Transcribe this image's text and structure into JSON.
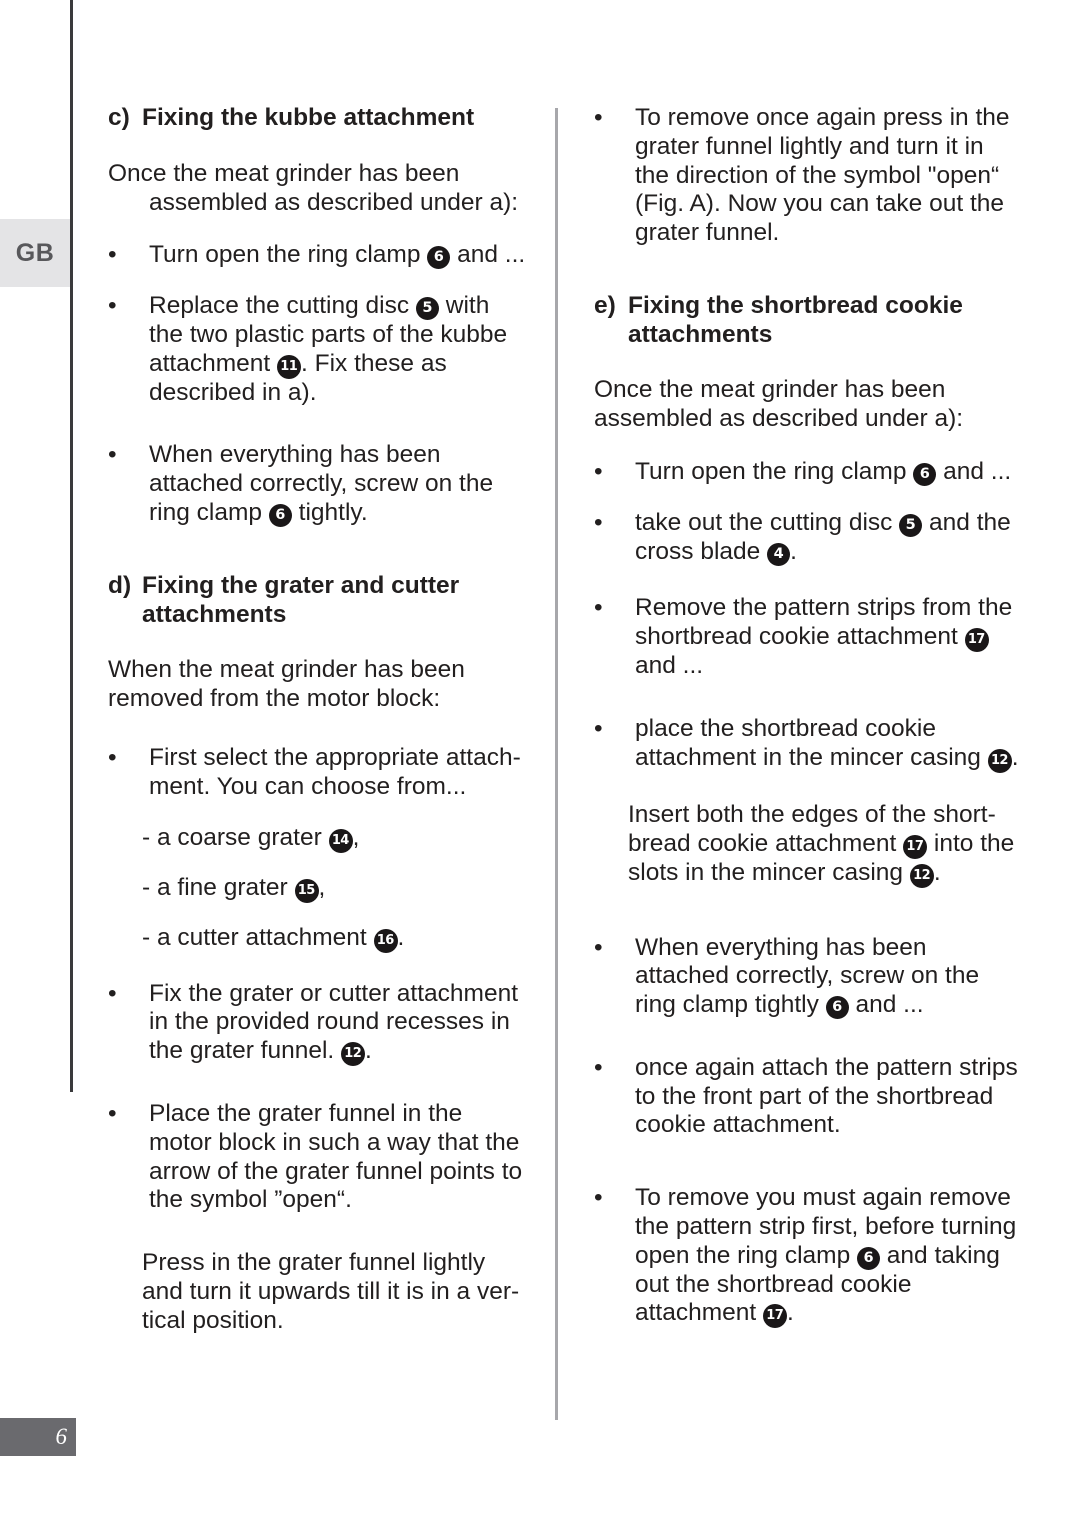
{
  "page": {
    "language_tab": "GB",
    "page_number": "6"
  },
  "left_column": {
    "section_c": {
      "marker": "c)",
      "title": "Fixing the kubbe attachment",
      "intro": "Once the meat grinder has been assembled as described under a):",
      "bullets": [
        {
          "parts": [
            {
              "type": "text",
              "value": "Turn open the ring clamp "
            },
            {
              "type": "badge",
              "value": "6"
            },
            {
              "type": "text",
              "value": " and ..."
            }
          ]
        },
        {
          "parts": [
            {
              "type": "text",
              "value": "Replace the cutting disc "
            },
            {
              "type": "badge",
              "value": "5"
            },
            {
              "type": "text",
              "value": " with the two plastic parts of the kubbe attachment "
            },
            {
              "type": "badge",
              "value": "11"
            },
            {
              "type": "text",
              "value": ". Fix these as described in a)."
            }
          ]
        },
        {
          "parts": [
            {
              "type": "text",
              "value": "When everything has been attached correctly, screw on the ring clamp "
            },
            {
              "type": "badge",
              "value": "6"
            },
            {
              "type": "text",
              "value": " tightly."
            }
          ]
        }
      ]
    },
    "section_d": {
      "marker": "d)",
      "title": "Fixing the grater and cutter attachments",
      "intro": "When the meat grinder has been removed from the motor block:",
      "bullet_first": {
        "parts": [
          {
            "type": "text",
            "value": "First select the appropriate attach-ment. You can choose from..."
          }
        ]
      },
      "bullet_first_text": "First select the appropriate attach­ment. You can choose from...",
      "dash_items": [
        {
          "parts": [
            {
              "type": "text",
              "value": "- a coarse grater "
            },
            {
              "type": "badge",
              "value": "14"
            },
            {
              "type": "text",
              "value": ","
            }
          ]
        },
        {
          "parts": [
            {
              "type": "text",
              "value": "- a fine grater "
            },
            {
              "type": "badge",
              "value": "15"
            },
            {
              "type": "text",
              "value": ","
            }
          ]
        },
        {
          "parts": [
            {
              "type": "text",
              "value": "- a cutter attachment "
            },
            {
              "type": "badge",
              "value": "16"
            },
            {
              "type": "text",
              "value": "."
            }
          ]
        }
      ],
      "bullets": [
        {
          "parts": [
            {
              "type": "text",
              "value": "Fix the grater or cutter attachment in the provided round recesses in the grater funnel. "
            },
            {
              "type": "badge",
              "value": "12"
            },
            {
              "type": "text",
              "value": "."
            }
          ]
        },
        {
          "parts": [
            {
              "type": "text",
              "value": "Place the grater funnel in the motor block in such a way that the arrow of the grater funnel points to the symbol ”open“."
            }
          ]
        }
      ],
      "closing_para": "Press in the grater funnel lightly and turn it upwards till it is in a ver­tical position."
    }
  },
  "right_column": {
    "top_bullet": {
      "parts": [
        {
          "type": "text",
          "value": "To remove once again press in the grater funnel lightly and turn it in the direction of the symbol \"open“ (Fig. A). Now you can take out the grater funnel."
        }
      ]
    },
    "section_e": {
      "marker": "e)",
      "title": "Fixing the shortbread cookie attachments",
      "intro": "Once the meat grinder has been assembled as described under a):",
      "bullets": [
        {
          "parts": [
            {
              "type": "text",
              "value": "Turn open the ring clamp "
            },
            {
              "type": "badge",
              "value": "6"
            },
            {
              "type": "text",
              "value": " and ..."
            }
          ]
        },
        {
          "parts": [
            {
              "type": "text",
              "value": "take out the cutting disc "
            },
            {
              "type": "badge",
              "value": "5"
            },
            {
              "type": "text",
              "value": " and the cross blade "
            },
            {
              "type": "badge",
              "value": "4"
            },
            {
              "type": "text",
              "value": "."
            }
          ]
        },
        {
          "parts": [
            {
              "type": "text",
              "value": "Remove the pattern strips from the shortbread cookie attachment "
            },
            {
              "type": "badge",
              "value": "17"
            },
            {
              "type": "text",
              "value": " and ..."
            }
          ]
        },
        {
          "parts": [
            {
              "type": "text",
              "value": "place the shortbread cookie attachment in the mincer casing "
            },
            {
              "type": "badge",
              "value": "12"
            },
            {
              "type": "text",
              "value": "."
            }
          ]
        }
      ],
      "insert_para": {
        "parts": [
          {
            "type": "text",
            "value": "Insert both the edges of the short­bread cookie attachment "
          },
          {
            "type": "badge",
            "value": "17"
          },
          {
            "type": "text",
            "value": " into the slots in the mincer casing "
          },
          {
            "type": "badge",
            "value": "12"
          },
          {
            "type": "text",
            "value": "."
          }
        ]
      },
      "bullets_after": [
        {
          "parts": [
            {
              "type": "text",
              "value": "When everything has been attached correctly, screw on the ring clamp tightly "
            },
            {
              "type": "badge",
              "value": "6"
            },
            {
              "type": "text",
              "value": " and ..."
            }
          ]
        },
        {
          "parts": [
            {
              "type": "text",
              "value": "once again attach the pattern strips to the front part of the short­bread cookie attachment."
            }
          ]
        },
        {
          "parts": [
            {
              "type": "text",
              "value": "To remove you must again remove the pattern strip first, before turn­ing open the ring clamp "
            },
            {
              "type": "badge",
              "value": "6"
            },
            {
              "type": "text",
              "value": " and taking out the shortbread cookie attachment "
            },
            {
              "type": "badge",
              "value": "17"
            },
            {
              "type": "text",
              "value": "."
            }
          ]
        }
      ]
    }
  },
  "glyphs": {
    "bullet_dot": "•"
  }
}
